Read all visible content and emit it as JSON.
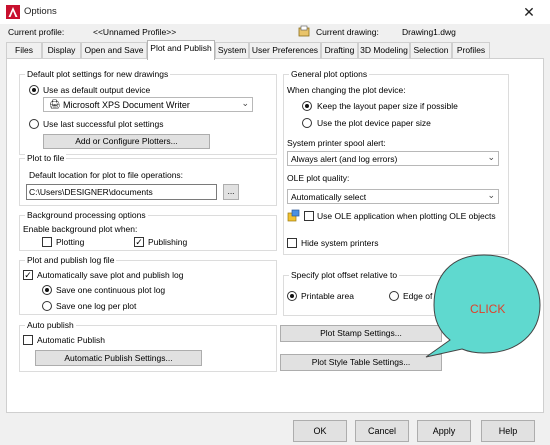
{
  "window": {
    "title": "Options",
    "close": "✕"
  },
  "profile": {
    "label": "Current profile:",
    "value": "<<Unnamed Profile>>"
  },
  "drawing": {
    "label": "Current drawing:",
    "value": "Drawing1.dwg"
  },
  "tabs": [
    "Files",
    "Display",
    "Open and Save",
    "Plot and Publish",
    "System",
    "User Preferences",
    "Drafting",
    "3D Modeling",
    "Selection",
    "Profiles"
  ],
  "default_plot": {
    "title": "Default plot settings for new drawings",
    "use_default": "Use as default output device",
    "device": "Microsoft XPS Document Writer",
    "use_last": "Use last successful plot settings",
    "add_plotters": "Add or Configure Plotters..."
  },
  "plot_to_file": {
    "title": "Plot to file",
    "label": "Default location for plot to file operations:",
    "path": "C:\\Users\\DESIGNER\\documents",
    "browse": "..."
  },
  "background": {
    "title": "Background processing options",
    "label": "Enable background plot when:",
    "plotting": "Plotting",
    "publishing": "Publishing"
  },
  "log": {
    "title": "Plot and publish log file",
    "auto_save": "Automatically save plot and publish log",
    "continuous": "Save one continuous plot log",
    "per_plot": "Save one log per plot"
  },
  "auto_publish": {
    "title": "Auto publish",
    "checkbox": "Automatic Publish",
    "settings": "Automatic Publish Settings..."
  },
  "general": {
    "title": "General plot options",
    "when_changing": "When changing the plot device:",
    "keep_layout": "Keep the layout paper size if possible",
    "use_device": "Use the plot device paper size",
    "spool_label": "System printer spool alert:",
    "spool_value": "Always alert (and log errors)",
    "ole_label": "OLE plot quality:",
    "ole_value": "Automatically select",
    "use_ole": "Use OLE application when plotting OLE objects",
    "hide_printers": "Hide system printers"
  },
  "offset": {
    "title": "Specify plot offset relative to",
    "printable": "Printable area",
    "edge": "Edge of paper"
  },
  "stamp_btn": "Plot Stamp Settings...",
  "style_btn": "Plot Style Table Settings...",
  "callout": {
    "text": "CLICK",
    "fill": "#5fd9cf",
    "text_color": "#e0402a"
  },
  "footer": {
    "ok": "OK",
    "cancel": "Cancel",
    "apply": "Apply",
    "help": "Help"
  }
}
